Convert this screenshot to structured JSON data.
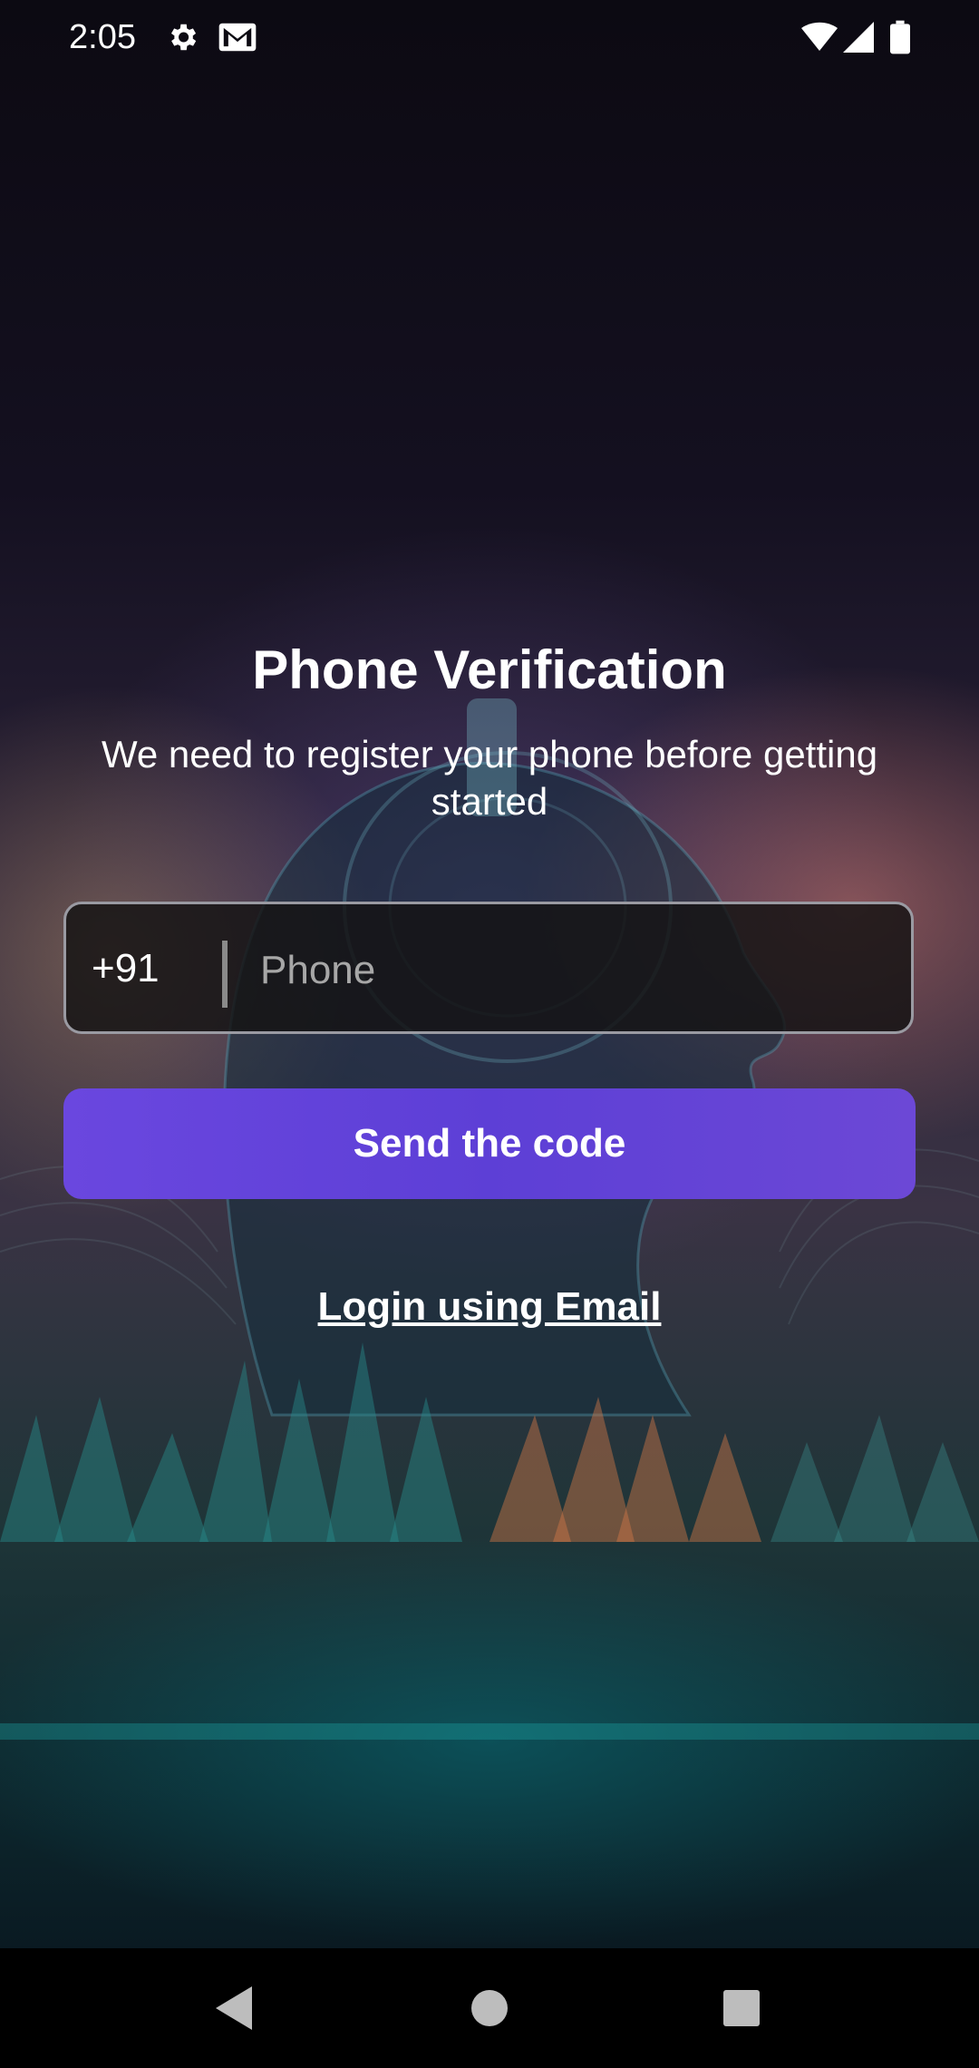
{
  "status_bar": {
    "time": "2:05",
    "icons": [
      "gear-icon",
      "gmail-icon",
      "wifi-icon",
      "cell-signal-icon",
      "battery-icon"
    ]
  },
  "verification": {
    "title": "Phone Verification",
    "subtitle": "We need to register your phone before getting started",
    "country_code": "+91",
    "phone_placeholder": "Phone",
    "send_button_label": "Send the code",
    "email_login_label": "Login using Email"
  },
  "colors": {
    "button": "#5d3fd6",
    "text": "#ffffff",
    "input_border": "#9a9aa2"
  },
  "nav_bar": {
    "icons": [
      "back-icon",
      "home-icon",
      "recents-icon"
    ]
  }
}
